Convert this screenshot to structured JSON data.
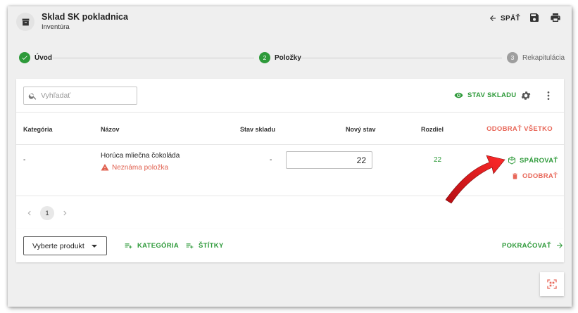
{
  "header": {
    "title": "Sklad SK pokladnica",
    "subtitle": "Inventúra",
    "back_label": "SPÄŤ"
  },
  "stepper": {
    "steps": [
      {
        "number": "1",
        "label": "Úvod",
        "state": "done"
      },
      {
        "number": "2",
        "label": "Položky",
        "state": "active"
      },
      {
        "number": "3",
        "label": "Rekapitulácia",
        "state": "pending"
      }
    ]
  },
  "toolbar": {
    "search_placeholder": "Vyhľadať",
    "stock_label": "STAV SKLADU"
  },
  "table": {
    "headers": {
      "category": "Kategória",
      "name": "Názov",
      "stock": "Stav skladu",
      "new_stock": "Nový stav",
      "difference": "Rozdiel",
      "remove_all": "ODOBRAŤ VŠETKO"
    },
    "rows": [
      {
        "category": "-",
        "name": "Horúca mliečna čokoláda",
        "warning": "Neznáma položka",
        "stock": "-",
        "new_stock": "22",
        "difference": "22",
        "pair_label": "SPÁROVAŤ",
        "remove_label": "ODOBRAŤ"
      }
    ]
  },
  "pagination": {
    "current": "1"
  },
  "bottom": {
    "select_product": "Vyberte produkt",
    "category_label": "KATEGÓRIA",
    "tags_label": "ŠTÍTKY",
    "continue_label": "POKRAČOVAŤ"
  },
  "colors": {
    "accent_green": "#2e9a3a",
    "danger_red": "#e8685a",
    "arrow_red": "#e5141b"
  }
}
